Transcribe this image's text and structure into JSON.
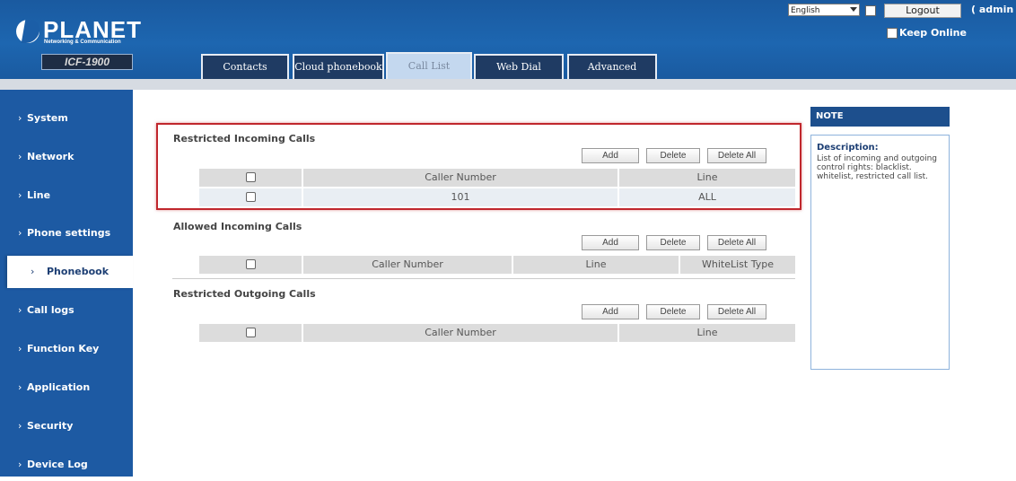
{
  "header": {
    "brand": "PLANET",
    "brand_tagline": "Networking & Communication",
    "model": "ICF-1900",
    "language": "English",
    "logout_label": "Logout",
    "user": "( admin )",
    "keep_online_label": "Keep Online"
  },
  "tabs": [
    "Contacts",
    "Cloud phonebook",
    "Call List",
    "Web Dial",
    "Advanced"
  ],
  "active_tab": "Call List",
  "sidebar": {
    "items": [
      "System",
      "Network",
      "Line",
      "Phone settings",
      "Phonebook",
      "Call logs",
      "Function Key",
      "Application",
      "Security",
      "Device Log"
    ],
    "active": "Phonebook"
  },
  "sections": {
    "restricted_incoming": {
      "title": "Restricted Incoming Calls",
      "buttons": {
        "add": "Add",
        "delete": "Delete",
        "delete_all": "Delete All"
      },
      "columns": [
        "Caller Number",
        "Line"
      ],
      "rows": [
        {
          "caller_number": "101",
          "line": "ALL"
        }
      ]
    },
    "allowed_incoming": {
      "title": "Allowed Incoming Calls",
      "buttons": {
        "add": "Add",
        "delete": "Delete",
        "delete_all": "Delete All"
      },
      "columns": [
        "Caller Number",
        "Line",
        "WhiteList Type"
      ]
    },
    "restricted_outgoing": {
      "title": "Restricted Outgoing Calls",
      "buttons": {
        "add": "Add",
        "delete": "Delete",
        "delete_all": "Delete All"
      },
      "columns": [
        "Caller Number",
        "Line"
      ]
    }
  },
  "note": {
    "heading": "NOTE",
    "title": "Description:",
    "text": "List of incoming and outgoing control rights: blacklist.  whitelist, restricted call list."
  },
  "colors": {
    "header_blue": "#1d66b0",
    "sidebar_blue": "#1d5aa3",
    "highlight_red": "#c0272d"
  }
}
